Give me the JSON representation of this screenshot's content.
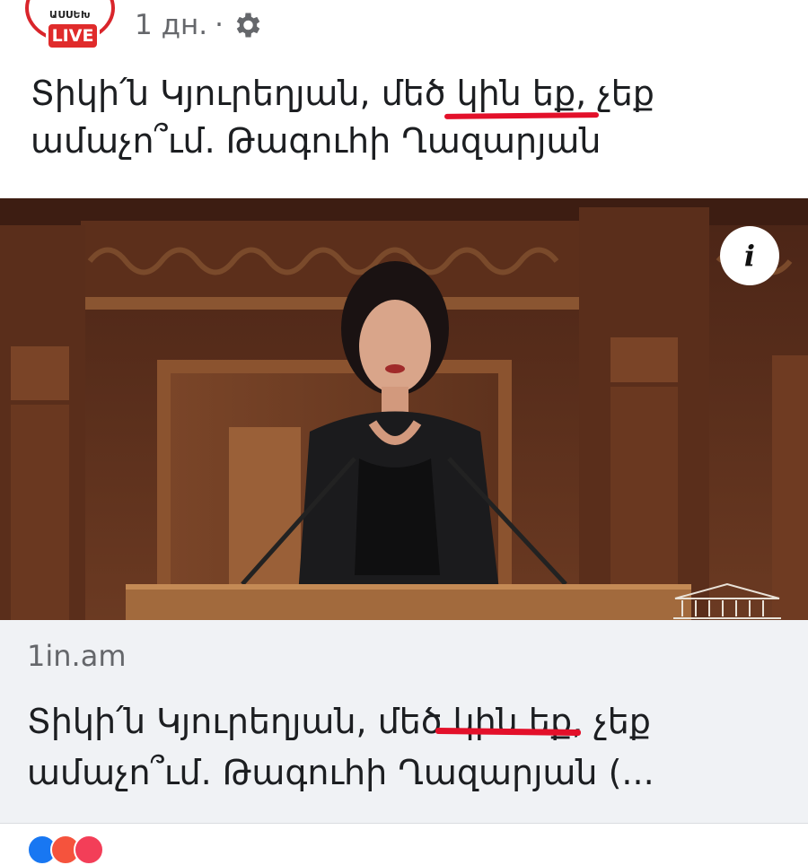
{
  "post": {
    "avatar_text": "ԱՍՍԵԽ",
    "live_label": "LIVE",
    "time": "1 дн.",
    "separator": "·",
    "privacy_icon": "gear-icon",
    "title": "Տիկի՛ն Կյուրեղյան, մեծ կին եք, չեք ամաչո՞ւմ. Թագուհի Ղազարյան"
  },
  "media": {
    "info_label": "i",
    "info_icon": "info-icon"
  },
  "link_card": {
    "domain": "1in.am",
    "title": "Տիկի՛ն Կյուրեղյան, մեծ կին եք, չեք ամաչո՞ւմ. Թագուհի Ղազարյան (..."
  },
  "colors": {
    "live_red": "#e02b2b",
    "underline_red": "#e3102a",
    "meta_gray": "#65676b",
    "card_bg": "#f0f2f5"
  }
}
